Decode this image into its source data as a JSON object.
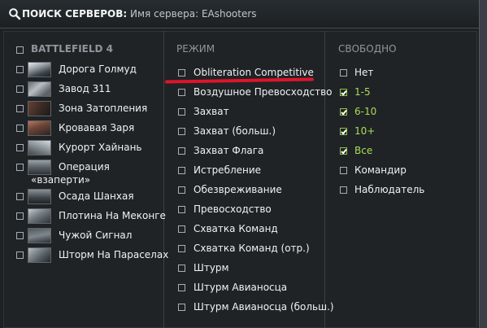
{
  "search": {
    "label": "ПОИСК СЕРВЕРОВ:",
    "value": "Имя сервера: EAshooters",
    "icon": "search-icon"
  },
  "games": {
    "header": "BATTLEFIELD 4",
    "maps": [
      {
        "label": "Дорога Голмуд"
      },
      {
        "label": "Завод 311"
      },
      {
        "label": "Зона Затопления"
      },
      {
        "label": "Кровавая Заря"
      },
      {
        "label": "Курорт Хайнань"
      },
      {
        "label": "Операция"
      },
      {
        "label": "«взаперти»"
      },
      {
        "label": "Осада Шанхая"
      },
      {
        "label": "Плотина На Меконге"
      },
      {
        "label": "Чужой Сигнал"
      },
      {
        "label": "Шторм На Параселах"
      }
    ]
  },
  "modes": {
    "header": "РЕЖИМ",
    "items": [
      {
        "label": "Obliteration Competitive"
      },
      {
        "label": "Воздушное Превосходство"
      },
      {
        "label": "Захват"
      },
      {
        "label": "Захват (больш.)"
      },
      {
        "label": "Захват Флага"
      },
      {
        "label": "Истребление"
      },
      {
        "label": "Обезвреживание"
      },
      {
        "label": "Превосходство"
      },
      {
        "label": "Схватка Команд"
      },
      {
        "label": "Схватка Команд (отр.)"
      },
      {
        "label": "Штурм"
      },
      {
        "label": "Штурм Авианосца"
      },
      {
        "label": "Штурм Авианосца (больш.)"
      }
    ]
  },
  "free": {
    "header": "СВОБОДНО",
    "items": [
      {
        "label": "Нет",
        "checked": false
      },
      {
        "label": "1-5",
        "checked": true
      },
      {
        "label": "6-10",
        "checked": true
      },
      {
        "label": "10+",
        "checked": true
      },
      {
        "label": "Все",
        "checked": true
      },
      {
        "label": "Командир",
        "checked": false
      },
      {
        "label": "Наблюдатель",
        "checked": false
      }
    ]
  },
  "colors": {
    "accent_green": "#a9dd55",
    "highlight_red": "#e0142a",
    "background": "#1f2326"
  }
}
